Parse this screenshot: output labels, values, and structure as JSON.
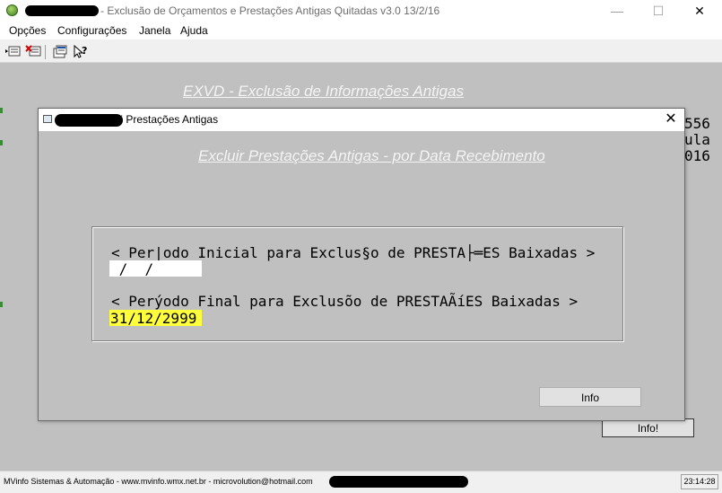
{
  "window": {
    "title": "- Exclusão de Orçamentos e Prestações Antigas Quitadas v3.0 13/2/16",
    "minimize_glyph": "—",
    "maximize_glyph": "☐",
    "close_glyph": "✕"
  },
  "menu": {
    "items": [
      "Opções",
      "Configurações",
      "Janela",
      "Ajuda"
    ]
  },
  "background": {
    "heading": "EXVD - Exclusão de Informações Antigas",
    "side_lines": [
      "556",
      "ula",
      "016"
    ],
    "info_button": "Info!"
  },
  "dialog": {
    "title": "Exclui Prestações Antigas",
    "close_glyph": "✕",
    "heading": "Excluir Prestações Antigas - por Data Recebimento",
    "start_label": "< Per|odo Inicial para Exclus§o de PRESTA├═ES Baixadas >",
    "start_value": " /  /",
    "end_label": "< Perýodo Final para Exclusõo de PRESTAÃíES Baixadas >",
    "end_value": "31/12/2999",
    "info_button": "Info"
  },
  "statusbar": {
    "text": "MVinfo Sistemas & Automação - www.mvinfo.wmx.net.br - microvolution@hotmail.com",
    "time": "23:14:28"
  },
  "colors": {
    "workarea_bg": "#c0c0c0",
    "highlight_input": "#ffff3c",
    "heading_text": "#f4f4f4"
  }
}
